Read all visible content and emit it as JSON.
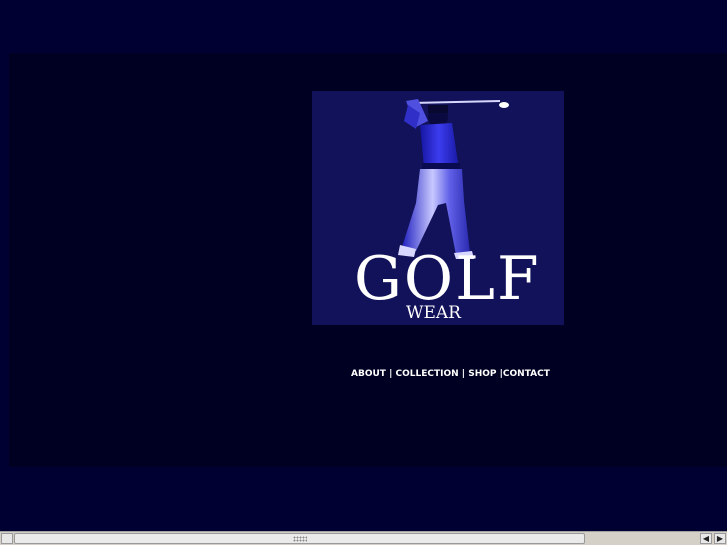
{
  "logo": {
    "title": "GOLF",
    "subtitle": "WEAR",
    "icon": "golfer-swing-icon"
  },
  "nav": {
    "items": [
      "ABOUT",
      "COLLECTION",
      "SHOP",
      "CONTACT"
    ],
    "separator_1": " | ",
    "separator_2": " | ",
    "separator_3": " |"
  },
  "colors": {
    "background": "#000033",
    "panel": "#000022",
    "logo_box": "#12125a",
    "golfer": "#3a3aff",
    "text": "#ffffff"
  },
  "scrollbar": {
    "left_arrow": "◀",
    "right_arrow": "▶",
    "start_arrow": ""
  }
}
